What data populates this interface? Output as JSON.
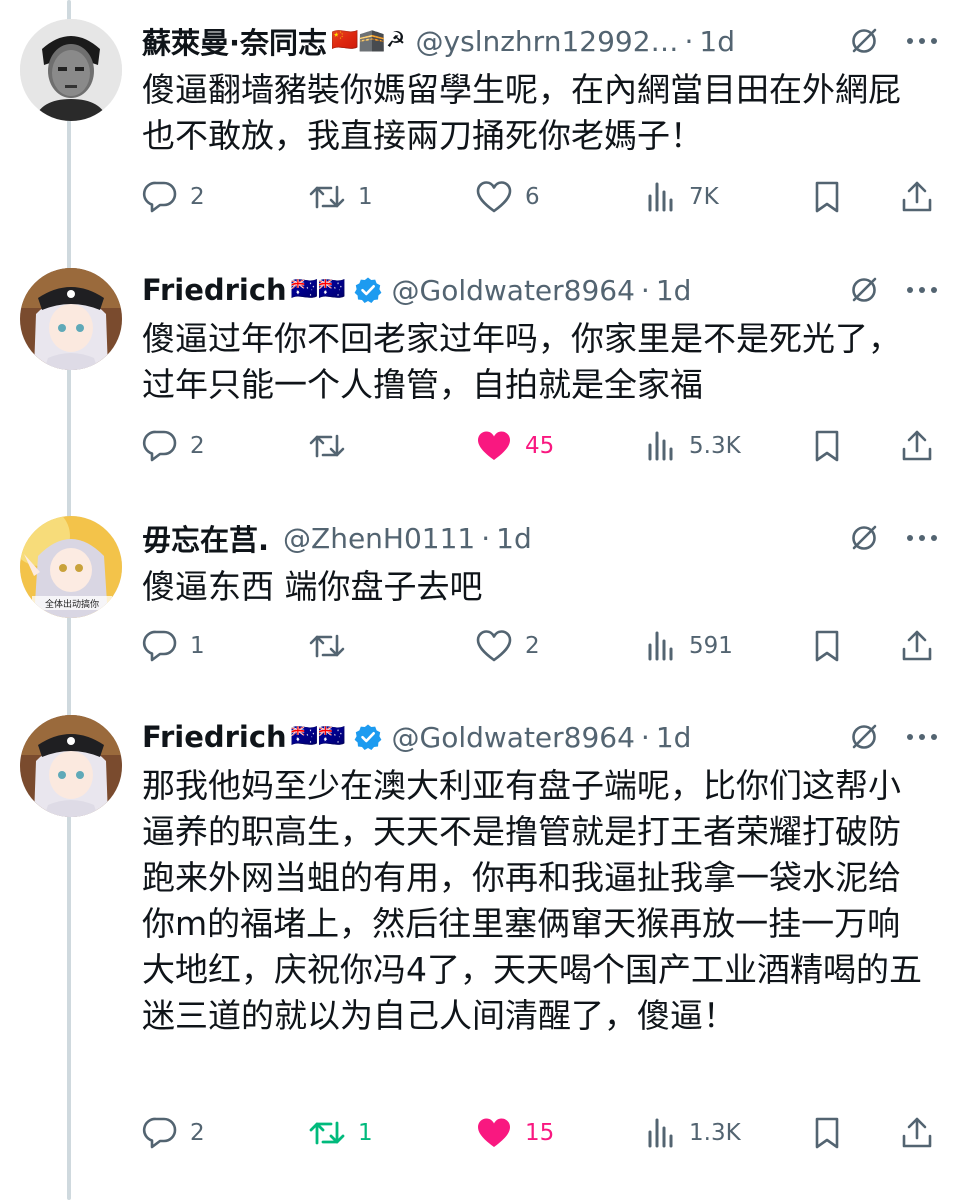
{
  "colors": {
    "like_active": "#f91880",
    "retweet_active": "#00ba7c",
    "verified": "#1d9bf0",
    "muted_text": "#536471",
    "thread_line": "#cfd9de"
  },
  "posts": [
    {
      "name": "蘇萊曼·奈同志",
      "emoji": "🇨🇳🕋☭",
      "verified": false,
      "handle": "@yslnzhrn12992…",
      "separator": "·",
      "time": "1d",
      "text": "傻逼翻墙豬裝你媽留學生呢，在內網當目田在外網屁也不敢放，我直接兩刀捅死你老媽子！",
      "replies": "2",
      "reposts": "1",
      "likes": "6",
      "views": "7K",
      "liked": false,
      "reposted": false
    },
    {
      "name": "Friedrich",
      "emoji": "🇦🇺🇦🇺",
      "verified": true,
      "handle": "@Goldwater8964",
      "separator": "·",
      "time": "1d",
      "text": "傻逼过年你不回老家过年吗，你家里是不是死光了，过年只能一个人撸管，自拍就是全家福",
      "replies": "2",
      "reposts": "",
      "likes": "45",
      "views": "5.3K",
      "liked": true,
      "reposted": false
    },
    {
      "name": "毋忘在莒.",
      "emoji": "",
      "verified": false,
      "handle": "@ZhenH0111",
      "separator": "·",
      "time": "1d",
      "text": "傻逼东西 端你盘子去吧",
      "replies": "1",
      "reposts": "",
      "likes": "2",
      "views": "591",
      "liked": false,
      "reposted": false
    },
    {
      "name": "Friedrich",
      "emoji": "🇦🇺🇦🇺",
      "verified": true,
      "handle": "@Goldwater8964",
      "separator": "·",
      "time": "1d",
      "text": "那我他妈至少在澳大利亚有盘子端呢，比你们这帮小逼养的职高生，天天不是撸管就是打王者荣耀打破防跑来外网当蛆的有用，你再和我逼扯我拿一袋水泥给你m的福堵上，然后往里塞俩窜天猴再放一挂一万响大地红，庆祝你冯4了，天天喝个国产工业酒精喝的五迷三道的就以为自己人间清醒了，傻逼！",
      "replies": "2",
      "reposts": "1",
      "likes": "15",
      "views": "1.3K",
      "liked": true,
      "reposted": true
    }
  ],
  "avatar_texts": {
    "post_3": "全体出动搞你"
  }
}
